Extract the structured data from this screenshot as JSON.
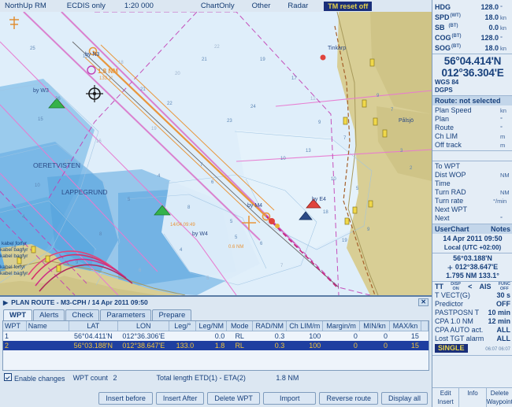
{
  "topbar": {
    "items": [
      {
        "label": "NorthUp RM"
      },
      {
        "label": "ECDIS only"
      },
      {
        "label": "1:20 000"
      },
      {
        "label": "ChartOnly"
      },
      {
        "label": "Other"
      },
      {
        "label": "Radar"
      }
    ],
    "tm_reset": "TM reset off"
  },
  "chart": {
    "labels": [
      {
        "text": "OERETVISTEN"
      },
      {
        "text": "LAPPEGRUND"
      },
      {
        "text": "Tinkarp"
      },
      {
        "text": "Pålsjö"
      },
      {
        "text": "by N3"
      },
      {
        "text": "by W3"
      },
      {
        "text": "by M4"
      },
      {
        "text": "by E4"
      },
      {
        "text": "by W4"
      },
      {
        "text": "kabel forfyr"
      },
      {
        "text": "kabel bagfyr"
      }
    ],
    "annotations": [
      {
        "text": "1.8 NM"
      },
      {
        "text": "133.1°"
      },
      {
        "text": "14/04 09:49"
      },
      {
        "text": "0.6 NM"
      }
    ]
  },
  "sidebar": {
    "nav": [
      {
        "label": "HDG",
        "sup": "",
        "value": "128.0",
        "unit": "°"
      },
      {
        "label": "SPD",
        "sup": "(WT)",
        "value": "18.0",
        "unit": "kn"
      },
      {
        "label": "SB",
        "sup": "(BT)",
        "value": "0.0",
        "unit": "kn"
      },
      {
        "label": "COG",
        "sup": "(BT)",
        "value": "128.0",
        "unit": "°"
      },
      {
        "label": "SOG",
        "sup": "(BT)",
        "value": "18.0",
        "unit": "kn"
      }
    ],
    "position": {
      "lat": "56°04.414'N",
      "lon": "012°36.304'E",
      "datum": "WGS 84",
      "source": "DGPS"
    },
    "route": {
      "title": "Route: not selected",
      "rows": [
        {
          "label": "Plan Speed",
          "value": "",
          "unit": "kn"
        },
        {
          "label": "Plan",
          "value": "",
          "unit": "°"
        },
        {
          "label": "Route",
          "value": "",
          "unit": "°"
        },
        {
          "label": "Ch LIM",
          "value": "",
          "unit": "m"
        },
        {
          "label": "Off track",
          "value": "",
          "unit": "m"
        }
      ]
    },
    "wpt": {
      "rows": [
        {
          "label": "To WPT",
          "value": "",
          "unit": ""
        },
        {
          "label": "Dist WOP",
          "value": "",
          "unit": "NM"
        },
        {
          "label": "Time",
          "value": "",
          "unit": ""
        },
        {
          "label": "Turn RAD",
          "value": "",
          "unit": "NM"
        },
        {
          "label": "Turn rate",
          "value": "",
          "unit": "°/min"
        },
        {
          "label": "Next WPT",
          "value": "",
          "unit": ""
        },
        {
          "label": "Next",
          "value": "",
          "unit": "°"
        }
      ]
    },
    "userchart": {
      "left": "UserChart",
      "right": "Notes"
    },
    "time": {
      "datetime": "14 Apr 2011 09:50",
      "zone": "Local (UTC +02:00)"
    },
    "cursor": {
      "lat": "56°03.188'N",
      "lon": "012°38.647'E",
      "range_bearing": "1.795 NM  133.1°"
    },
    "targets": {
      "tt_label": "TT",
      "tt_state_top": "DISP",
      "tt_state_bot": "ON",
      "separator": "<",
      "ais_label": "AIS",
      "ais_state_top": "FUNC",
      "ais_state_bot": "OFF",
      "rows": [
        {
          "label": "T VECT(G)",
          "value": "30 s"
        },
        {
          "label": "Predictor",
          "value": "OFF"
        },
        {
          "label": "PASTPOSN T",
          "value": "10 min"
        },
        {
          "label": "CPA   1.0 NM",
          "value": "12 min"
        },
        {
          "label": "CPA AUTO act.",
          "value": "ALL"
        },
        {
          "label": "Lost TGT alarm",
          "value": "ALL"
        }
      ],
      "mode_badge": "SINGLE",
      "timestamps": "06:07  06:07"
    },
    "buttons": [
      {
        "top": "Edit",
        "bottom": "Insert"
      },
      {
        "top": "Info",
        "bottom": ""
      },
      {
        "top": "Delete",
        "bottom": "Waypoint"
      }
    ]
  },
  "plan": {
    "title": "PLAN ROUTE - M3-CPH / 14 Apr 2011 09:50",
    "close_label": "✕",
    "tabs": [
      {
        "label": "WPT",
        "active": true
      },
      {
        "label": "Alerts",
        "active": false
      },
      {
        "label": "Check",
        "active": false
      },
      {
        "label": "Parameters",
        "active": false
      },
      {
        "label": "Prepare",
        "active": false
      }
    ],
    "table": {
      "columns": [
        "WPT",
        "Name",
        "LAT",
        "LON",
        "Leg/°",
        "Leg/NM",
        "Mode",
        "RAD/NM",
        "Ch LIM/m",
        "Margin/m",
        "MIN/kn",
        "MAX/kn"
      ],
      "rows": [
        {
          "selected": false,
          "cells": [
            "1",
            "",
            "56°04.411'N",
            "012°36.306'E",
            "",
            "0.0",
            "RL",
            "0.3",
            "100",
            "0",
            "0",
            "15"
          ]
        },
        {
          "selected": true,
          "cells": [
            "2",
            "",
            "56°03.188'N",
            "012°38.647'E",
            "133.0",
            "1.8",
            "RL",
            "0.3",
            "100",
            "0",
            "0",
            "15"
          ]
        }
      ]
    },
    "status": {
      "enable_changes": "Enable changes",
      "wpt_count_label": "WPT count",
      "wpt_count_value": "2",
      "total_label": "Total length ETD(1) - ETA(2)",
      "total_value": "1.8 NM"
    },
    "buttons": [
      {
        "label": "Insert before"
      },
      {
        "label": "Insert After"
      },
      {
        "label": "Delete WPT"
      },
      {
        "label": "Import"
      },
      {
        "label": "Reverse route"
      },
      {
        "label": "Display all"
      }
    ]
  },
  "colors": {
    "accent": "#1a2f7a",
    "highlight": "#e8d44a",
    "sea": "#dfeefa",
    "land": "#cfc68e",
    "panel": "#dce7f2"
  }
}
